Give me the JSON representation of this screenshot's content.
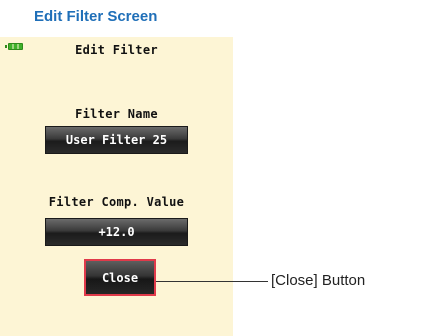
{
  "heading": "Edit Filter Screen",
  "device": {
    "screen_title": "Edit Filter",
    "filter_name": {
      "label": "Filter Name",
      "value": "User Filter 25"
    },
    "filter_comp": {
      "label": "Filter Comp. Value",
      "value": "+12.0"
    },
    "close_label": "Close",
    "battery_icon": "battery-icon"
  },
  "callout": {
    "text": "[Close] Button"
  },
  "colors": {
    "heading": "#1f6fb8",
    "screen_bg": "#fdf5d5",
    "highlight": "#e03a4a",
    "battery": "#3fb12a"
  }
}
